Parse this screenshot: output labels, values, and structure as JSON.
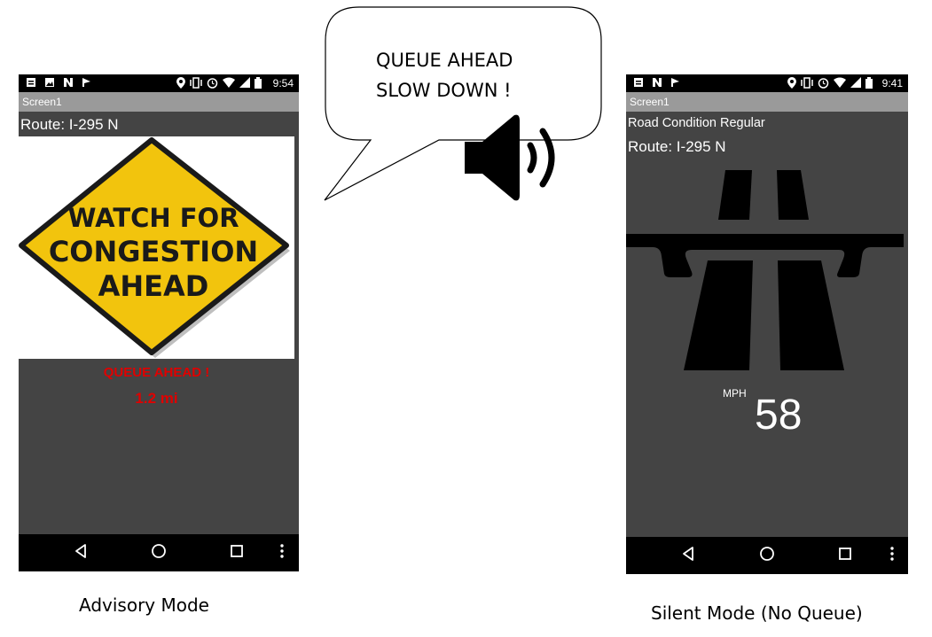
{
  "advisory_phone": {
    "status_time": "9:54",
    "title": "Screen1",
    "route": "Route: I-295 N",
    "sign": {
      "line1": "WATCH FOR",
      "line2": "CONGESTION",
      "line3": "AHEAD"
    },
    "alert": "QUEUE AHEAD !",
    "distance": "1.2 mi"
  },
  "silent_phone": {
    "status_time": "9:41",
    "title": "Screen1",
    "road_condition": "Road Condition Regular",
    "route": "Route: I-295 N",
    "speed_unit": "MPH",
    "speed": "58"
  },
  "speech_bubble": {
    "line1": "QUEUE AHEAD",
    "line2": "SLOW DOWN !"
  },
  "captions": {
    "left": "Advisory Mode",
    "right": "Silent Mode (No Queue)"
  },
  "colors": {
    "alert_red": "#e00000",
    "sign_yellow": "#f2c40d",
    "screen_bg": "#444444"
  },
  "icons": [
    "notification-icon",
    "image-icon",
    "n-icon",
    "flag-icon",
    "location-icon",
    "vibrate-icon",
    "alarm-icon",
    "wifi-icon",
    "signal-icon",
    "battery-icon",
    "speaker-icon",
    "back-icon",
    "home-icon",
    "recents-icon",
    "overflow-menu-icon"
  ]
}
